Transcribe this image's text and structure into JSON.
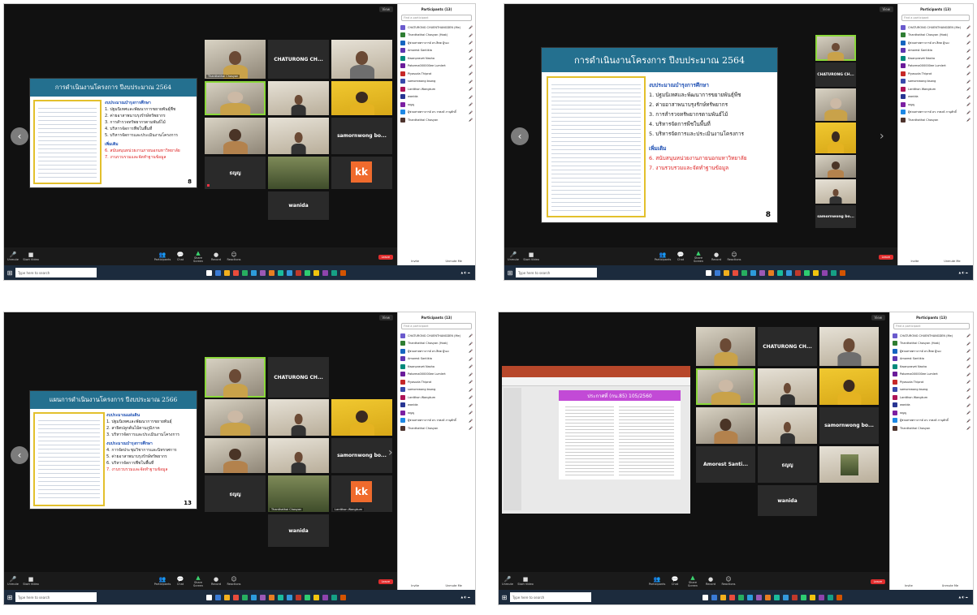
{
  "common": {
    "participants_title": "Participants (13)",
    "search_placeholder": "Find a participant",
    "invite": "Invite",
    "unmute_me": "Unmute Me",
    "end": "Leave",
    "taskbar_search": "Type here to search",
    "toolbar": {
      "unmute": "Unmute",
      "start_video": "Start Video",
      "participants": "Participants",
      "chat": "Chat",
      "share_screen": "Share Screen",
      "record": "Record",
      "reactions": "Reactions"
    },
    "tiles": {
      "chaturong": "CHATURONG CH...",
      "samorn": "samornwong bo...",
      "thaj": "ธญญ",
      "wanida": "wanida",
      "amorest": "Amorest Santi...",
      "kk": "kk",
      "chaturong_label": "Thanthathai Chosyan",
      "lardthon": "Lardthon Wangkum"
    },
    "colors": {
      "accent_green": "#8bd83b",
      "kk_orange": "#f06b2d",
      "end_red": "#e02d2d"
    }
  },
  "participants": [
    {
      "name": "CHATURONG CHUENTHANGDEN (Me)",
      "color": "#6a5acd"
    },
    {
      "name": "Thanthathai Chosyan (Host)",
      "color": "#2e7d32"
    },
    {
      "name": "ผู้ช่วยศาสตราจารย์ ดร.สิตต ผู้รอง",
      "color": "#1565c0"
    },
    {
      "name": "Amorest Santikia",
      "color": "#5e35b1"
    },
    {
      "name": "Kwanpravet Nasha",
      "color": "#00897b"
    },
    {
      "name": "Patorma000000ee Lumlert",
      "color": "#6a1b9a"
    },
    {
      "name": "Piyasuda Thiprot",
      "color": "#c62828"
    },
    {
      "name": "samornwong bsong",
      "color": "#3949ab"
    },
    {
      "name": "Lardthon Wangkum",
      "color": "#ad1457"
    },
    {
      "name": "wanida",
      "color": "#283593"
    },
    {
      "name": "ธญญ",
      "color": "#7b1fa2"
    },
    {
      "name": "ผู้ช่วยศาสตราจารย์ ดร.วรพงษ์ ภานุศักดิ์",
      "color": "#1e88e5"
    },
    {
      "name": "Thanthathai Chosyan",
      "color": "#4e342e"
    }
  ],
  "slides": {
    "s1": {
      "title": "การดำเนินงานโครงการ ปีงบประมาณ 2564",
      "page": "8",
      "heading": "งบประมาณบำรุงการศึกษา",
      "items": [
        "1. ปฐมนิเทศและพัฒนาการขยายพันธุ์พืช",
        "2. ค่ายอาสาพนาบรุงรักษ์ทรัพยากร",
        "3. การสำรวจทรัพยากรตามพันธ์ไม้",
        "4. บริหารจัดการพืชในพื้นที่",
        "5. บริหารจัดการและประเมินงานโครงการ"
      ],
      "heading2": "เพิ่มเติม",
      "items2": [
        "6. สนับสนุนหน่วยงานภายนอกมหาวิทยาลัย",
        "7. งานรวบรวมและจัดทำฐานข้อมูล"
      ]
    },
    "s3": {
      "title": "แผนการดำเนินงานโครงการ ปีงบประมาณ 2566",
      "page": "13",
      "heading": "งบประมาณแผ่นดิน",
      "items": [
        "1. ปฐมนิเทศและพัฒนาการขยายพันธุ์",
        "2. สาธิตปลูกต้นไม้ตามภูมิภาค",
        "3. บริหารจัดการและประเมินงานโครงการ"
      ],
      "heading2": "งบประมาณบำรุงการศึกษา",
      "items2": [
        "4. การจัดประชุมวิชาการและนิทรรศการ",
        "5. ค่ายอาสาพนาบรุงรักษ์ทรัพยากร",
        "6. บริหารจัดการพืชในพื้นที่",
        "7. งานรวบรวมและจัดทำฐานข้อมูล"
      ]
    },
    "s4": {
      "title": "ประกาศที่ (กน.85) 105/2560"
    }
  }
}
